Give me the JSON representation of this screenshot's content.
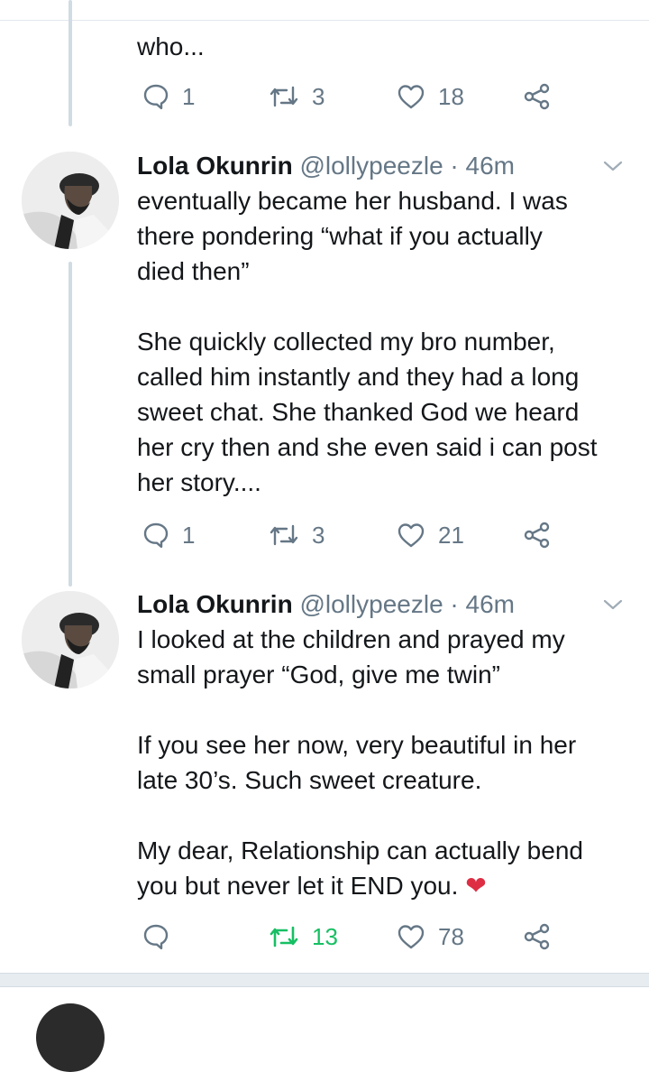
{
  "tweets": [
    {
      "text": "who...",
      "reply_count": "1",
      "retweet_count": "3",
      "like_count": "18"
    },
    {
      "name": "Lola Okunrin",
      "handle": "@lollypeezle",
      "separator": "·",
      "time": "46m",
      "text": "eventually became her husband. I was\nthere pondering “what if you actually\ndied then”\n\nShe quickly collected my bro number,\ncalled him instantly and they had a long\nsweet chat. She thanked God we heard\nher cry then and she even said i can post\nher story....",
      "reply_count": "1",
      "retweet_count": "3",
      "like_count": "21"
    },
    {
      "name": "Lola Okunrin",
      "handle": "@lollypeezle",
      "separator": "·",
      "time": "46m",
      "text": "I looked at the children and prayed my\nsmall prayer “God, give me twin”\n\nIf you see her now, very beautiful in her\nlate 30’s. Such sweet creature.\n\nMy dear, Relationship can actually bend\nyou but never let it END you.",
      "emoji": "❤",
      "reply_count": "",
      "retweet_count": "13",
      "like_count": "78"
    }
  ],
  "colors": {
    "text": "#14171a",
    "muted": "#657786",
    "retweet_active": "#17bf63",
    "heart_emoji": "#dd2e44",
    "thread_line": "#d0dbe3"
  },
  "icons": [
    "reply-icon",
    "retweet-icon",
    "like-icon",
    "share-icon",
    "chevron-down-icon"
  ]
}
